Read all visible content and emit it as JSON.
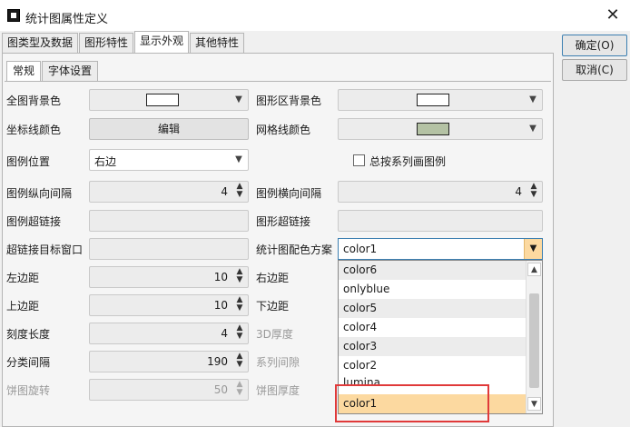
{
  "window": {
    "title": "统计图属性定义",
    "close": "✕"
  },
  "tabs": [
    "图类型及数据",
    "图形特性",
    "显示外观",
    "其他特性"
  ],
  "subtabs": [
    "常规",
    "字体设置"
  ],
  "buttons": {
    "ok": "确定(O)",
    "cancel": "取消(C)"
  },
  "left": {
    "bg_color": "全图背景色",
    "axis_color": "坐标线颜色",
    "axis_edit": "编辑",
    "legend_pos": "图例位置",
    "legend_pos_value": "右边",
    "legend_vgap": "图例纵向间隔",
    "legend_vgap_value": "4",
    "legend_link": "图例超链接",
    "link_target": "超链接目标窗口",
    "left_margin": "左边距",
    "left_margin_value": "10",
    "top_margin": "上边距",
    "top_margin_value": "10",
    "tick_len": "刻度长度",
    "tick_len_value": "4",
    "cat_gap": "分类间隔",
    "cat_gap_value": "190",
    "pie_rot": "饼图旋转",
    "pie_rot_value": "50"
  },
  "right": {
    "plot_bg": "图形区背景色",
    "grid_color": "网格线颜色",
    "legend_by_series": "总按系列画图例",
    "legend_hgap": "图例横向间隔",
    "legend_hgap_value": "4",
    "graph_link": "图形超链接",
    "color_scheme": "统计图配色方案",
    "color_scheme_value": "color1",
    "right_margin": "右边距",
    "bottom_margin": "下边距",
    "depth_3d": "3D厚度",
    "series_gap": "系列间隙",
    "pie_thickness": "饼图厚度"
  },
  "colors": {
    "bg_swatch": "#ffffff",
    "plot_swatch": "#ffffff",
    "grid_swatch": "#b4c2a4"
  },
  "dropdown": {
    "items": [
      "color6",
      "onlyblue",
      "color5",
      "color4",
      "color3",
      "color2",
      "lumina",
      "color1"
    ],
    "selected": "color1"
  }
}
